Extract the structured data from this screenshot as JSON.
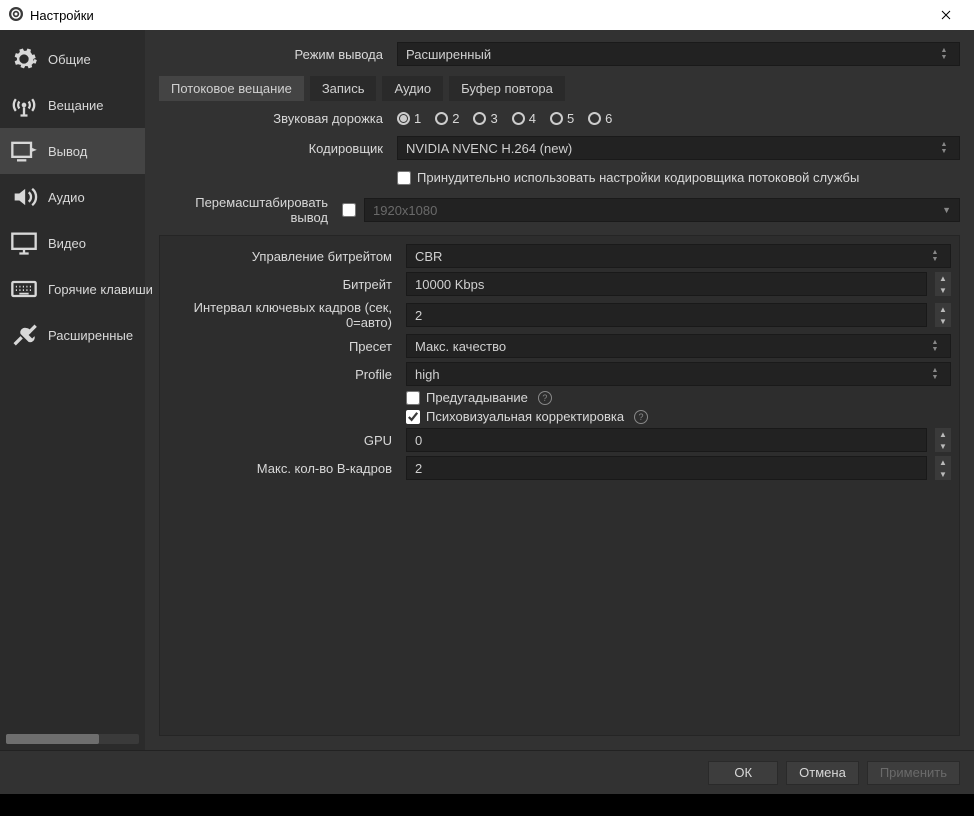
{
  "title": "Настройки",
  "sidebar": {
    "items": [
      {
        "label": "Общие"
      },
      {
        "label": "Вещание"
      },
      {
        "label": "Вывод"
      },
      {
        "label": "Аудио"
      },
      {
        "label": "Видео"
      },
      {
        "label": "Горячие клавиши"
      },
      {
        "label": "Расширенные"
      }
    ]
  },
  "output_mode": {
    "label": "Режим вывода",
    "value": "Расширенный"
  },
  "tabs": [
    {
      "label": "Потоковое вещание"
    },
    {
      "label": "Запись"
    },
    {
      "label": "Аудио"
    },
    {
      "label": "Буфер повтора"
    }
  ],
  "audio_track": {
    "label": "Звуковая дорожка",
    "selected": "1",
    "options": [
      "1",
      "2",
      "3",
      "4",
      "5",
      "6"
    ]
  },
  "encoder": {
    "label": "Кодировщик",
    "value": "NVIDIA NVENC H.264 (new)"
  },
  "force_service": {
    "label": "Принудительно использовать настройки кодировщика потоковой службы"
  },
  "rescale": {
    "label": "Перемасштабировать вывод",
    "placeholder": "1920x1080"
  },
  "bitrate_control": {
    "label": "Управление битрейтом",
    "value": "CBR"
  },
  "bitrate": {
    "label": "Битрейт",
    "value": "10000 Kbps"
  },
  "keyframe": {
    "label": "Интервал ключевых кадров (сек, 0=авто)",
    "value": "2"
  },
  "preset": {
    "label": "Пресет",
    "value": "Макс. качество"
  },
  "profile": {
    "label": "Profile",
    "value": "high"
  },
  "lookahead": {
    "label": "Предугадывание"
  },
  "psycho": {
    "label": "Психовизуальная корректировка"
  },
  "gpu": {
    "label": "GPU",
    "value": "0"
  },
  "bframes": {
    "label": "Макс. кол-во B-кадров",
    "value": "2"
  },
  "buttons": {
    "ok": "ОК",
    "cancel": "Отмена",
    "apply": "Применить"
  }
}
